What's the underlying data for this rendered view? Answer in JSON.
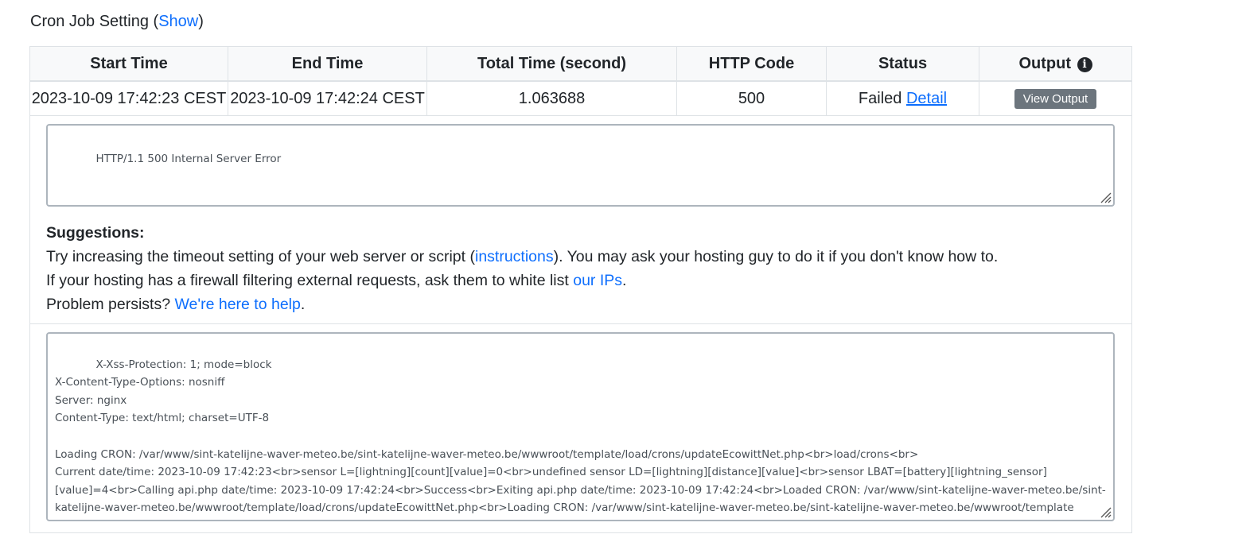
{
  "cron_setting": {
    "title_prefix": "Cron Job Setting (",
    "show_link": "Show",
    "title_suffix": ")"
  },
  "table": {
    "headers": {
      "start_time": "Start Time",
      "end_time": "End Time",
      "total_time": "Total Time (second)",
      "http_code": "HTTP Code",
      "status": "Status",
      "output": "Output",
      "output_icon": "info-circle-icon"
    },
    "row": {
      "start_time": "2023-10-09 17:42:23 CEST",
      "end_time": "2023-10-09 17:42:24 CEST",
      "total_time": "1.063688",
      "http_code": "500",
      "status": "Failed",
      "detail_link": "Detail",
      "view_output_button": "View Output"
    }
  },
  "error_box": {
    "text": "HTTP/1.1 500 Internal Server Error"
  },
  "suggestions": {
    "heading": "Suggestions:",
    "line1_before": "Try increasing the timeout setting of your web server or script (",
    "line1_link": "instructions",
    "line1_after": "). You may ask your hosting guy to do it if you don't know how to.",
    "line2_before": "If your hosting has a firewall filtering external requests, ask them to white list ",
    "line2_link": "our IPs",
    "line2_after": ".",
    "line3_before": "Problem persists? ",
    "line3_link": "We're here to help",
    "line3_after": "."
  },
  "output_box": {
    "text": "X-Xss-Protection: 1; mode=block\nX-Content-Type-Options: nosniff\nServer: nginx\nContent-Type: text/html; charset=UTF-8\n\nLoading CRON: /var/www/sint-katelijne-waver-meteo.be/sint-katelijne-waver-meteo.be/wwwroot/template/load/crons/updateEcowittNet.php<br>load/crons<br>\nCurrent date/time: 2023-10-09 17:42:23<br>sensor L=[lightning][count][value]=0<br>undefined sensor LD=[lightning][distance][value]<br>sensor LBAT=[battery][lightning_sensor]\n[value]=4<br>Calling api.php date/time: 2023-10-09 17:42:24<br>Success<br>Exiting api.php date/time: 2023-10-09 17:42:24<br>Loaded CRON: /var/www/sint-katelijne-waver-meteo.be/sint-\nkatelijne-waver-meteo.be/wwwroot/template/load/crons/updateEcowittNet.php<br>Loading CRON: /var/www/sint-katelijne-waver-meteo.be/sint-katelijne-waver-meteo.be/wwwroot/template\n/load/crons/updateWLL.php<br>"
  }
}
